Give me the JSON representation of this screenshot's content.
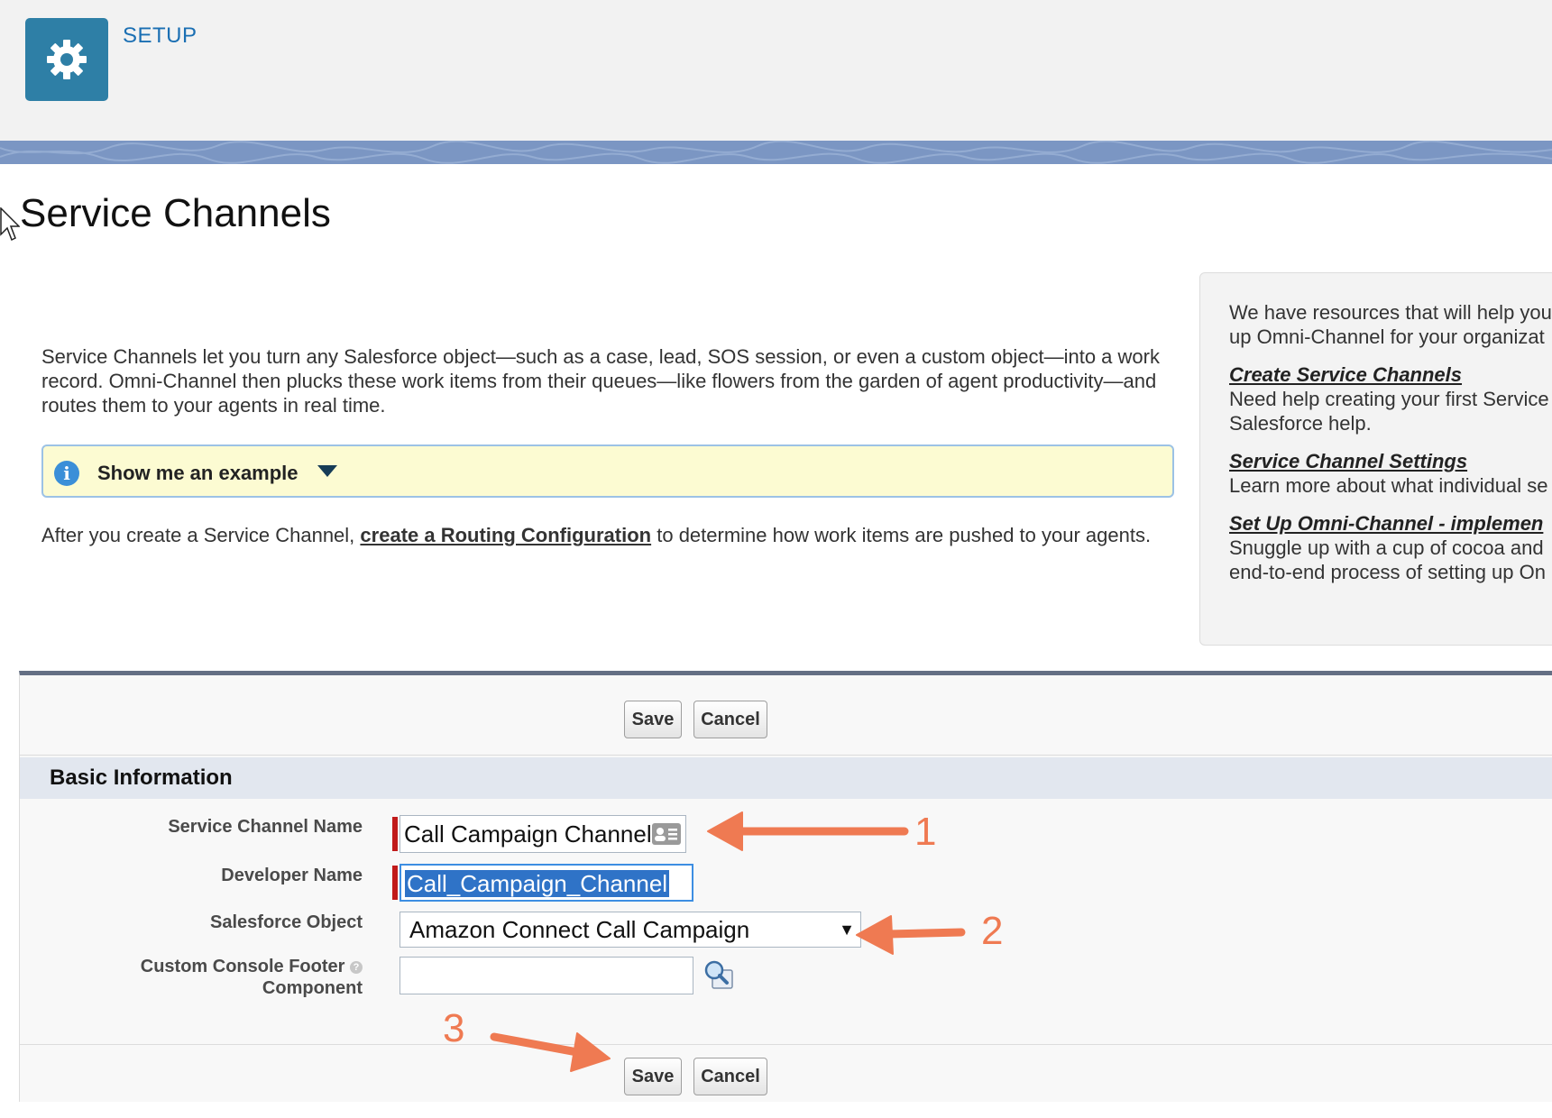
{
  "header": {
    "app_label": "SETUP",
    "icon": "gear-icon"
  },
  "page": {
    "title": "Service Channels",
    "intro": "Service Channels let you turn any Salesforce object—such as a case, lead, SOS session, or even a custom object—into a work record. Omni-Channel then plucks these work items from their queues—like flowers from the garden of agent productivity—and routes them to your agents in real time.",
    "example_toggle": "Show me an example",
    "after_prefix": "After you create a Service Channel,",
    "after_link": "create a Routing Configuration",
    "after_suffix": "to determine how work items are pushed to your agents."
  },
  "side_panel": {
    "intro_line1": "We have resources that will help you",
    "intro_line2": "up Omni-Channel for your organizat",
    "links": [
      {
        "title": "Create Service Channels",
        "desc_line1": "Need help creating your first Service",
        "desc_line2": "Salesforce help."
      },
      {
        "title": "Service Channel Settings",
        "desc_line1": "Learn more about what individual se",
        "desc_line2": ""
      },
      {
        "title": "Set Up Omni-Channel - implemen",
        "desc_line1": "Snuggle up with a cup of cocoa and",
        "desc_line2": "end-to-end process of setting up On"
      }
    ]
  },
  "form": {
    "save_label": "Save",
    "cancel_label": "Cancel",
    "section_title": "Basic Information",
    "fields": {
      "service_channel_name": {
        "label": "Service Channel Name",
        "value": "Call Campaign Channel"
      },
      "developer_name": {
        "label": "Developer Name",
        "value": "Call_Campaign_Channel"
      },
      "salesforce_object": {
        "label": "Salesforce Object",
        "value": "Amazon Connect Call Campaign"
      },
      "custom_console_footer": {
        "label_line1": "Custom Console Footer",
        "label_line2": "Component",
        "value": ""
      }
    }
  },
  "annotations": {
    "marker_1": "1",
    "marker_2": "2",
    "marker_3": "3",
    "arrow_color": "#ef7a52"
  }
}
